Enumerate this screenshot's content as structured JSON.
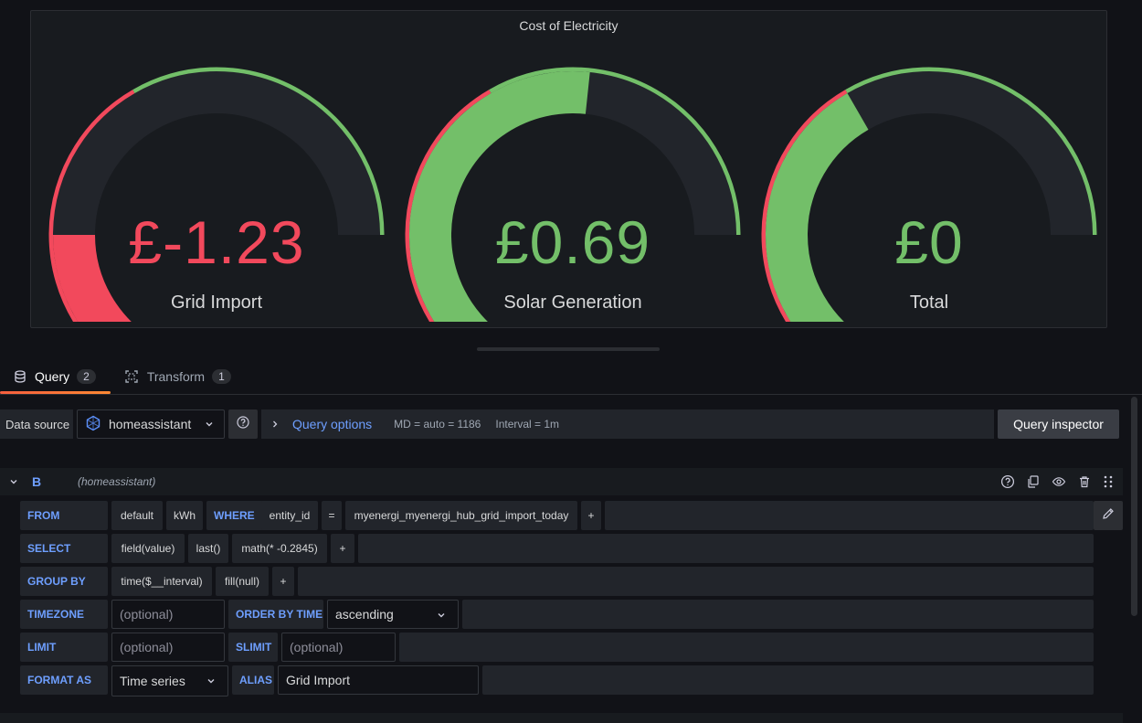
{
  "panel": {
    "title": "Cost of Electricity",
    "gauges": [
      {
        "value": "£-1.23",
        "label": "Grid Import",
        "color": "#f2495c",
        "fill_fraction": 0.25
      },
      {
        "value": "£0.69",
        "label": "Solar Generation",
        "color": "#73bf69",
        "fill_fraction": 0.65
      },
      {
        "value": "£0",
        "label": "Total",
        "color": "#73bf69",
        "fill_fraction": 0.5
      }
    ],
    "colors": {
      "red": "#f2495c",
      "green": "#73bf69",
      "track": "#22252b"
    }
  },
  "tabs": [
    {
      "label": "Query",
      "count": "2",
      "icon": "database-icon"
    },
    {
      "label": "Transform",
      "count": "1",
      "icon": "transform-icon"
    }
  ],
  "toolbar": {
    "datasource_label": "Data source",
    "datasource": "homeassistant",
    "query_options": "Query options",
    "md": "MD = auto = 1186",
    "interval": "Interval = 1m",
    "inspector": "Query inspector"
  },
  "query": {
    "ref_id": "B",
    "datasource_name": "(homeassistant)",
    "from": {
      "keyword": "FROM",
      "policy": "default",
      "measurement": "kWh",
      "where_keyword": "WHERE",
      "tag_key": "entity_id",
      "operator": "=",
      "tag_value": "myenergi_myenergi_hub_grid_import_today",
      "add": "+"
    },
    "select": {
      "keyword": "SELECT",
      "parts": [
        "field(value)",
        "last()",
        "math(* -0.2845)"
      ],
      "add": "+"
    },
    "group_by": {
      "keyword": "GROUP BY",
      "parts": [
        "time($__interval)",
        "fill(null)"
      ],
      "add": "+"
    },
    "timezone": {
      "keyword": "TIMEZONE",
      "placeholder": "(optional)"
    },
    "order_by": {
      "keyword": "ORDER BY TIME",
      "value": "ascending"
    },
    "limit": {
      "keyword": "LIMIT",
      "placeholder": "(optional)"
    },
    "slimit": {
      "keyword": "SLIMIT",
      "placeholder": "(optional)"
    },
    "format_as": {
      "keyword": "FORMAT AS",
      "value": "Time series"
    },
    "alias": {
      "keyword": "ALIAS",
      "value": "Grid Import"
    }
  }
}
